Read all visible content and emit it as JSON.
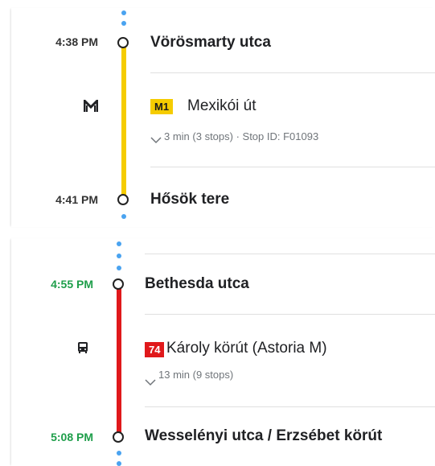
{
  "legs": [
    {
      "start_time": "4:38 PM",
      "start_stop": "Vörösmarty utca",
      "route_badge": "M1",
      "route_name": "Mexikói út",
      "details": "3 min (3 stops) · Stop ID: F01093",
      "end_time": "4:41 PM",
      "end_stop": "Hősök tere",
      "mode_icon": "metro-icon",
      "line_color": "#f5cc00",
      "badge_bg": "#f5cc00",
      "badge_fg": "#1a1a1a",
      "time_color": "#333333"
    },
    {
      "start_time": "4:55 PM",
      "start_stop": "Bethesda utca",
      "route_badge": "74",
      "route_name": "Károly körút (Astoria M)",
      "details": "13 min (9 stops)",
      "end_time": "5:08 PM",
      "end_stop": "Wesselényi utca / Erzsébet körút",
      "mode_icon": "bus-icon",
      "line_color": "#e0191b",
      "badge_bg": "#e0191b",
      "badge_fg": "#ffffff",
      "time_color": "#1e9e4a"
    }
  ],
  "walk_dot_color": "#4aa3f0"
}
